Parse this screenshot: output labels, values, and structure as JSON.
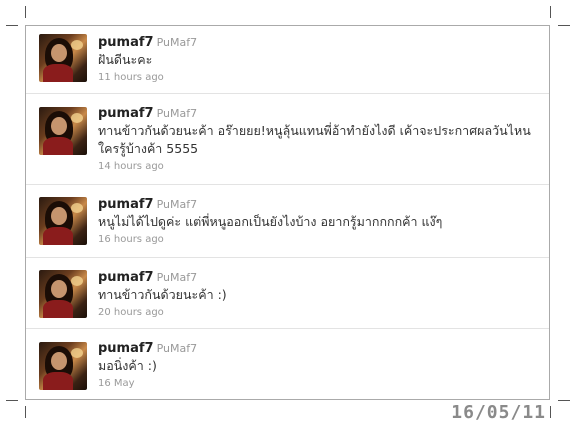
{
  "tweets": [
    {
      "username": "pumaf7",
      "handle": "PuMaf7",
      "text": "ฝันดีนะคะ",
      "time": "11 hours ago"
    },
    {
      "username": "pumaf7",
      "handle": "PuMaf7",
      "text": "ทานข้าวกันด้วยนะค้า อร๊ายยย!หนูลุ้นแทนพี่อ้าทำยังไงดี เค้าจะประกาศผลวันไหนใครรู้บ้างค้า 5555",
      "time": "14 hours ago"
    },
    {
      "username": "pumaf7",
      "handle": "PuMaf7",
      "text": "หนูไม่ได้ไปดูค่ะ แต่พี่หนูออกเป็นยังไงบ้าง อยากรู้มากกกกค้า แง๊ๆ",
      "time": "16 hours ago"
    },
    {
      "username": "pumaf7",
      "handle": "PuMaf7",
      "text": "ทานข้าวกันด้วยนะค้า :)",
      "time": "20 hours ago"
    },
    {
      "username": "pumaf7",
      "handle": "PuMaf7",
      "text": "มอนิ่งค้า :)",
      "time": "16 May"
    }
  ],
  "date_stamp": "16/05/11",
  "colors": {
    "username": "#222222",
    "handle": "#999999",
    "text": "#333333",
    "time": "#999999",
    "divider": "#e3e3e3",
    "date_stamp": "#8a8a8a"
  }
}
